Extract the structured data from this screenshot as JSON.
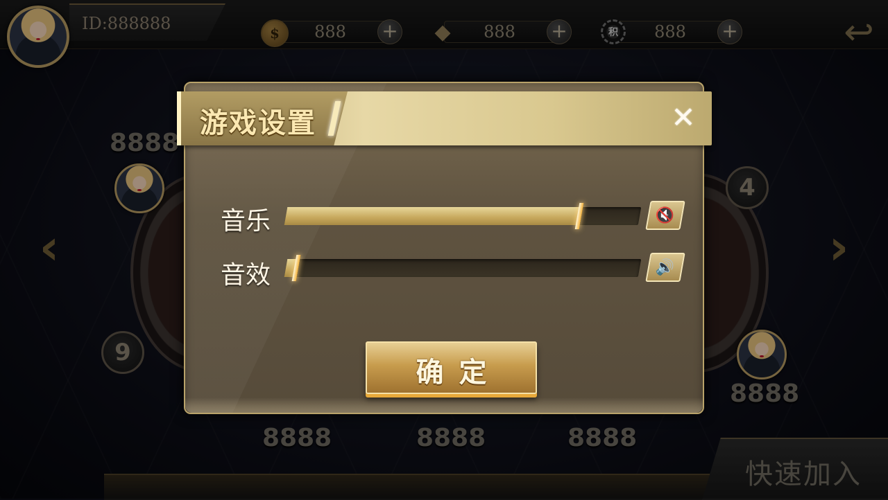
{
  "player": {
    "id_text": "ID:888888"
  },
  "resources": [
    {
      "icon": "coin-icon",
      "glyph": "$",
      "value": "888"
    },
    {
      "icon": "diamond-icon",
      "glyph": "◆",
      "value": "888"
    },
    {
      "icon": "chip-icon",
      "glyph": "积",
      "value": "888"
    }
  ],
  "plus_glyph": "+",
  "back_glyph": "↩",
  "background": {
    "seat_numbers": [
      "4",
      "9"
    ],
    "scores": [
      "8888",
      "8888",
      "8888",
      "8888",
      "8888"
    ],
    "nav_left": "‹",
    "nav_right": "›",
    "quick_join": "快速加入"
  },
  "dialog": {
    "title": "游戏设置",
    "close_glyph": "✕",
    "music": {
      "label": "音乐",
      "level": 0.83,
      "icon_glyph": "🔇"
    },
    "sound": {
      "label": "音效",
      "level": 0.03,
      "icon_glyph": "🔊"
    },
    "confirm_label": "确定"
  },
  "colors": {
    "gold_light": "#e7d8a6",
    "gold_dark": "#8a7647",
    "panel": "#5f5340",
    "thumb_glow": "#ffd27a"
  }
}
